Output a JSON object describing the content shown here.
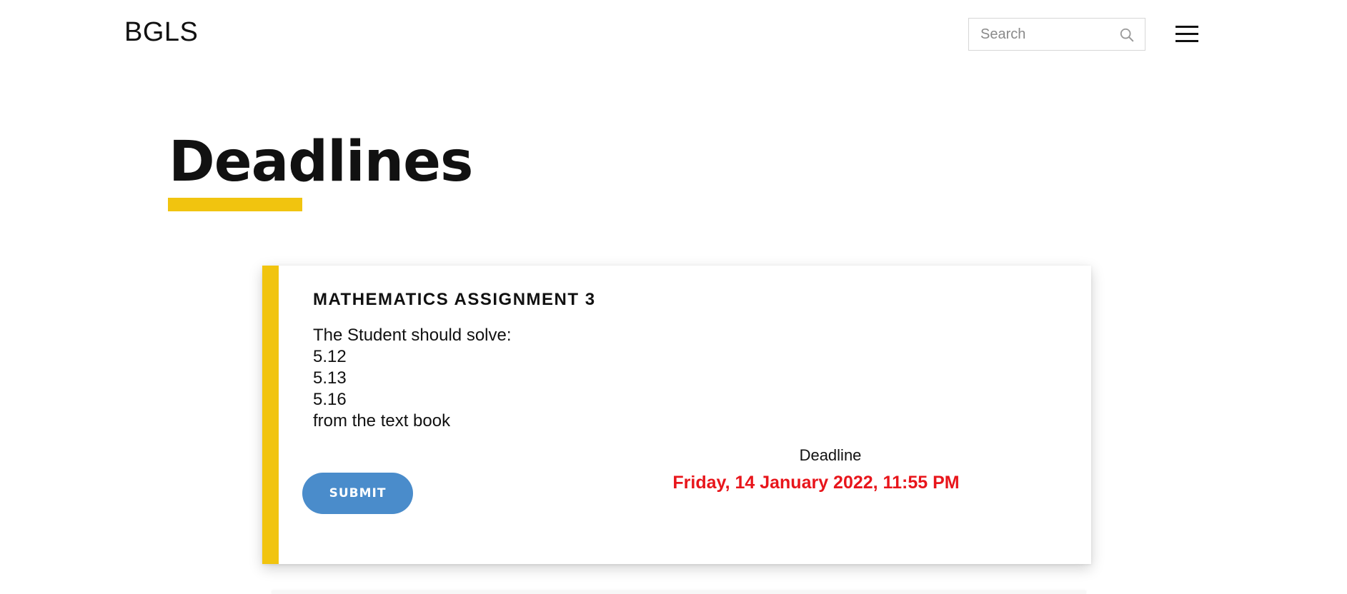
{
  "header": {
    "brand": "BGLS",
    "search": {
      "placeholder": "Search",
      "value": "",
      "icon": "search-icon"
    },
    "menu_icon": "hamburger-menu-icon"
  },
  "page": {
    "title": "Deadlines",
    "accent_color": "#f1c40f"
  },
  "assignments": [
    {
      "title": "MATHEMATICS ASSIGNMENT 3",
      "description_lines": [
        "The Student should solve:",
        "5.12",
        "5.13",
        "5.16",
        "from the text book"
      ],
      "submit_label": "SUBMIT",
      "deadline_label": "Deadline",
      "deadline_value": "Friday, 14 January 2022, 11:55 PM",
      "deadline_color": "#e8151b",
      "button_color": "#4a8ccb"
    }
  ]
}
